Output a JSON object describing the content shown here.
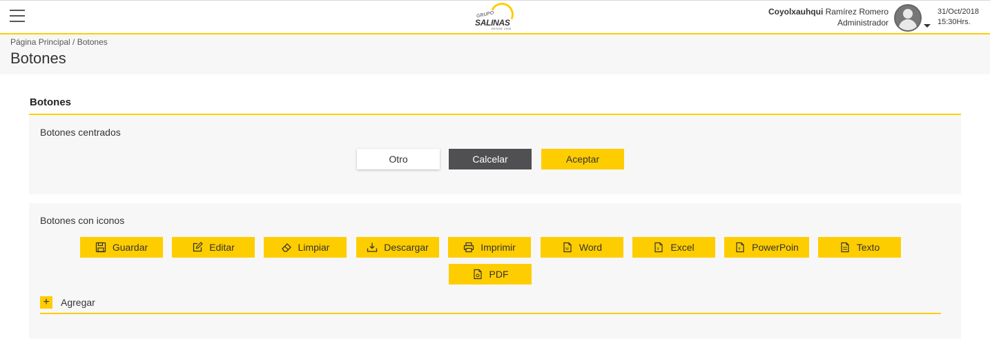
{
  "header": {
    "menu_icon": "hamburger-menu-icon",
    "logo": {
      "grupo": "GRUPO",
      "salinas": "SALINAS",
      "desde": "DESDE 1906"
    },
    "user": {
      "first_name": "Coyolxauhqui",
      "last_name": "Ramírez Romero",
      "role": "Administrador"
    },
    "avatar_icon": "user-avatar-icon",
    "date": "31/Oct/2018",
    "time": "15:30Hrs."
  },
  "page": {
    "breadcrumb": "Página Principal / Botones",
    "title": "Botones"
  },
  "section": {
    "title": "Botones",
    "centered": {
      "title": "Botones centrados",
      "buttons": {
        "other": "Otro",
        "cancel": "Calcelar",
        "accept": "Aceptar"
      }
    },
    "icons": {
      "title": "Botones con iconos",
      "buttons": {
        "save": "Guardar",
        "edit": "Editar",
        "clear": "Limpiar",
        "download": "Descargar",
        "print": "Imprimir",
        "word": "Word",
        "excel": "Excel",
        "powerpoint": "PowerPoin",
        "text": "Texto",
        "pdf": "PDF"
      },
      "add_label": "Agregar",
      "add_symbol": "+"
    }
  },
  "colors": {
    "accent": "#fecd00",
    "dark_button": "#505052",
    "panel_bg": "#f7f7f7"
  }
}
